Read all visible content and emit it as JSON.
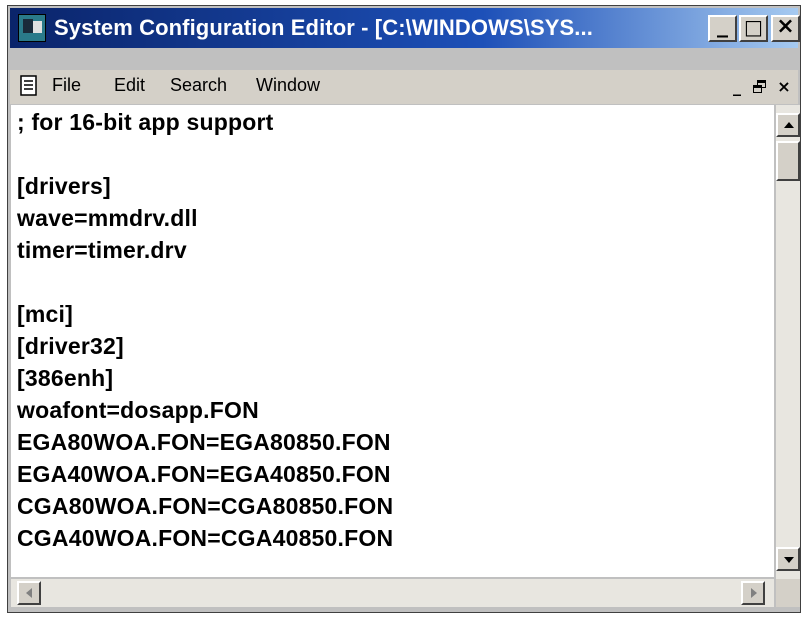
{
  "window": {
    "title": "System Configuration Editor - [C:\\WINDOWS\\SYS...",
    "controls": {
      "minimize": "_",
      "maximize": "□",
      "close": "×"
    }
  },
  "menu": {
    "items": [
      "File",
      "Edit",
      "Search",
      "Window"
    ],
    "mdi_controls": {
      "minimize": "_",
      "restore": "🗗",
      "close": "×"
    }
  },
  "document": {
    "lines": [
      "; for 16-bit app support",
      "",
      "[drivers]",
      "wave=mmdrv.dll",
      "timer=timer.drv",
      "",
      "[mci]",
      "[driver32]",
      "[386enh]",
      "woafont=dosapp.FON",
      "EGA80WOA.FON=EGA80850.FON",
      "EGA40WOA.FON=EGA40850.FON",
      "CGA80WOA.FON=CGA80850.FON",
      "CGA40WOA.FON=CGA40850.FON"
    ]
  },
  "colors": {
    "title_bar_start": "#0a246a",
    "title_bar_end": "#a6caf0",
    "chrome": "#d4d0c8"
  }
}
